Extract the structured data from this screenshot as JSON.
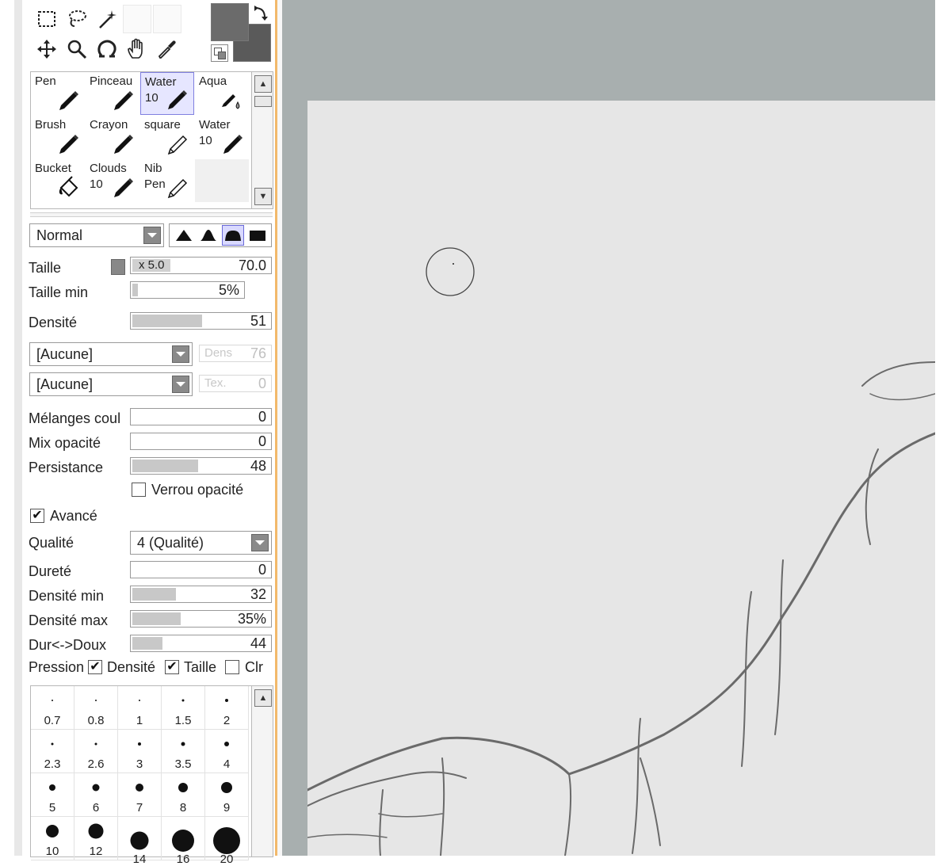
{
  "colors": {
    "primary": "#6b6b6b",
    "secondary": "#5a5a5a",
    "canvas_bg": "#a8afaf",
    "paper": "#e6e6e6",
    "panel_accent": "#f2b96b",
    "selection": "#e6e6ff"
  },
  "tools": [
    {
      "name": "rect-select-icon"
    },
    {
      "name": "lasso-icon"
    },
    {
      "name": "magic-wand-icon"
    },
    {
      "name": "move-icon"
    },
    {
      "name": "zoom-icon"
    },
    {
      "name": "rotate-icon"
    },
    {
      "name": "hand-icon"
    },
    {
      "name": "eyedropper-icon"
    }
  ],
  "brushes": [
    {
      "line1": "Pen",
      "line2": "",
      "selected": false
    },
    {
      "line1": "Pinceau",
      "line2": "",
      "selected": false
    },
    {
      "line1": "Water",
      "line2": "10",
      "selected": true
    },
    {
      "line1": "Aqua",
      "line2": "",
      "selected": false
    },
    {
      "line1": "Brush",
      "line2": "",
      "selected": false
    },
    {
      "line1": "Crayon",
      "line2": "",
      "selected": false
    },
    {
      "line1": "square",
      "line2": "",
      "selected": false
    },
    {
      "line1": "Water",
      "line2": "10",
      "selected": false
    },
    {
      "line1": "Bucket",
      "line2": "",
      "selected": false
    },
    {
      "line1": "Clouds",
      "line2": "10",
      "selected": false
    },
    {
      "line1": "Nib",
      "line2": "Pen",
      "selected": false
    }
  ],
  "blend_mode": "Normal",
  "size": {
    "label": "Taille",
    "multiplier": "x 5.0",
    "value": "70.0"
  },
  "min_size": {
    "label": "Taille min",
    "value": "5%",
    "fraction": 0.05
  },
  "density": {
    "label": "Densité",
    "value": "51",
    "fraction": 0.51
  },
  "texture1": {
    "value": "[Aucune]",
    "side_label": "Dens",
    "side_value": "76"
  },
  "texture2": {
    "value": "[Aucune]",
    "side_label": "Tex.",
    "side_value": "0"
  },
  "blending": {
    "label": "Mélanges coul",
    "value": "0",
    "fraction": 0.0
  },
  "dilution": {
    "label": "Mix opacité",
    "value": "0",
    "fraction": 0.0
  },
  "persistence": {
    "label": "Persistance",
    "value": "48",
    "fraction": 0.48
  },
  "keep_opacity": {
    "label": "Verrou opacité",
    "checked": false
  },
  "advanced": {
    "label": "Avancé",
    "checked": true
  },
  "quality": {
    "label": "Qualité",
    "value": "4 (Qualité)"
  },
  "hardness": {
    "label": "Dureté",
    "value": "0",
    "fraction": 0.0
  },
  "min_density": {
    "label": "Densité min",
    "value": "32",
    "fraction": 0.32
  },
  "max_density": {
    "label": "Densité max",
    "value": "35%",
    "fraction": 0.35
  },
  "hard_soft": {
    "label": "Dur<->Doux",
    "value": "44",
    "fraction": 0.22
  },
  "pressure": {
    "label": "Pression",
    "density_label": "Densité",
    "density_checked": true,
    "size_label": "Taille",
    "size_checked": true,
    "color_label": "Clr",
    "color_checked": false
  },
  "brush_sizes": [
    "0.7",
    "0.8",
    "1",
    "1.5",
    "2",
    "2.3",
    "2.6",
    "3",
    "3.5",
    "4",
    "5",
    "6",
    "7",
    "8",
    "9",
    "10",
    "12",
    "14",
    "16",
    "20"
  ]
}
